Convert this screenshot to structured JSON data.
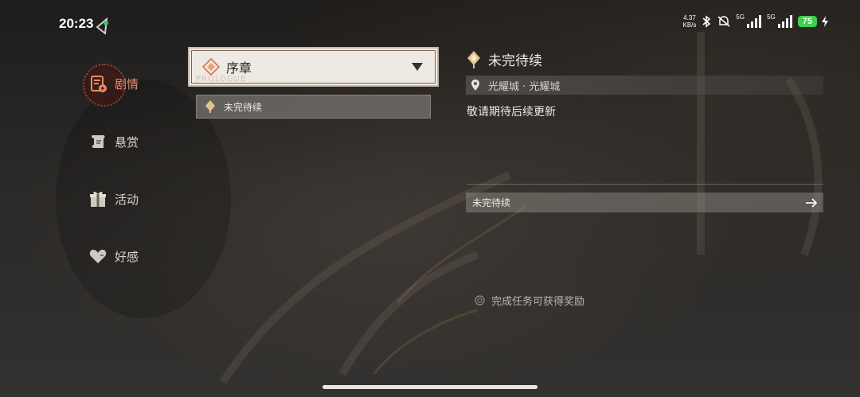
{
  "status_bar": {
    "time": "20:23",
    "net_speed_value": "4.37",
    "net_speed_unit": "KB/s",
    "net1": "5G",
    "net2": "5G",
    "battery": "75"
  },
  "sidebar": {
    "items": [
      {
        "label": "剧情",
        "icon": "story-icon",
        "active": true
      },
      {
        "label": "悬赏",
        "icon": "scroll-icon",
        "active": false
      },
      {
        "label": "活动",
        "icon": "gift-icon",
        "active": false
      },
      {
        "label": "好感",
        "icon": "heart-icon",
        "active": false
      }
    ]
  },
  "chapter": {
    "selected": "序章",
    "watermark": "PROLOGUE"
  },
  "quest_list": [
    {
      "label": "未完待续"
    }
  ],
  "detail": {
    "title": "未完待续",
    "location": "光耀城 · 光耀城",
    "description": "敬请期待后续更新",
    "continue_label": "未完待续",
    "reward_hint": "完成任务可获得奖励"
  },
  "colors": {
    "accent": "#e88a6d",
    "panel_light": "#efe9e3"
  }
}
